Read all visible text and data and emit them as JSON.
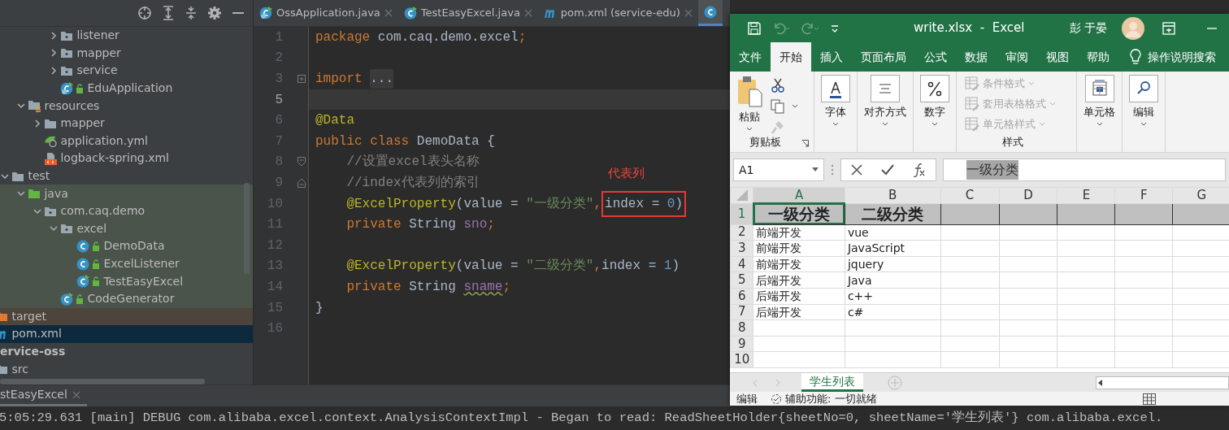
{
  "project": {
    "tree": [
      {
        "children": [
          {
            "children": [
              {
                "children": [
                  {
                    "children": [
                      {
                        "children": [
                          {
                            "label": "listener",
                            "kind": "package",
                            "expanded": false,
                            "selected": false
                          },
                          {
                            "label": "mapper",
                            "kind": "package",
                            "expanded": false,
                            "selected": false
                          },
                          {
                            "label": "service",
                            "kind": "package",
                            "expanded": false,
                            "selected": false
                          },
                          {
                            "label": "EduApplication",
                            "kind": "boot-class",
                            "selected": false
                          }
                        ]
                      }
                    ]
                  },
                  {
                    "label": "resources",
                    "kind": "resources",
                    "expanded": true,
                    "selected": false,
                    "children": [
                      {
                        "label": "mapper",
                        "kind": "folder",
                        "expanded": false,
                        "selected": false
                      },
                      {
                        "label": "application.yml",
                        "kind": "yml",
                        "selected": false
                      },
                      {
                        "label": "logback-spring.xml",
                        "kind": "xml",
                        "selected": false
                      }
                    ]
                  }
                ]
              },
              {
                "label": "test",
                "kind": "folder",
                "expanded": true,
                "selected": false,
                "children": [
                  {
                    "label": "java",
                    "kind": "test-root",
                    "expanded": true,
                    "selected": false,
                    "children": [
                      {
                        "label": "com.caq.demo",
                        "kind": "package",
                        "expanded": true,
                        "selected": false,
                        "children": [
                          {
                            "label": "excel",
                            "kind": "package",
                            "expanded": true,
                            "selected": false,
                            "children": [
                              {
                                "label": "DemoData",
                                "kind": "class",
                                "selected": false
                              },
                              {
                                "label": "ExcelListener",
                                "kind": "class",
                                "selected": false
                              },
                              {
                                "label": "TestEasyExcel",
                                "kind": "run-class",
                                "selected": false
                              }
                            ]
                          },
                          {
                            "label": "CodeGenerator",
                            "kind": "run-class",
                            "selected": false
                          }
                        ]
                      }
                    ]
                  }
                ]
              }
            ]
          },
          {
            "label": "target",
            "kind": "excluded-folder",
            "selected": false
          },
          {
            "label": "pom.xml",
            "kind": "maven",
            "selected": true
          }
        ]
      },
      {
        "label": "ervice-oss",
        "kind": "module",
        "selected": false,
        "children": [
          {
            "label": "src",
            "kind": "folder",
            "selected": false
          }
        ]
      }
    ]
  },
  "editor": {
    "tabs": [
      {
        "label": "OssApplication.java",
        "kind": "boot-class",
        "selected": false
      },
      {
        "label": "TestEasyExcel.java",
        "kind": "run-class",
        "selected": false
      },
      {
        "label": "pom.xml (service-edu)",
        "kind": "maven",
        "selected": false
      },
      {
        "kind": "class",
        "selected": true
      }
    ],
    "lines": [
      {
        "number": "1",
        "current": false,
        "tokens": [
          {
            "text": "package",
            "kind": "keyword"
          },
          {
            "text": " com.caq.demo.excel",
            "kind": "plain"
          },
          {
            "text": ";",
            "kind": "keyword"
          }
        ]
      },
      {
        "number": "2",
        "current": false
      },
      {
        "number": "3",
        "current": false,
        "fold": {
          "kind": "collapsed"
        },
        "tokens": [
          {
            "text": "import ",
            "kind": "keyword"
          },
          {
            "text": "...",
            "kind": "folded"
          }
        ]
      },
      {
        "number": "5",
        "current": true
      },
      {
        "number": "6",
        "current": false,
        "tokens": [
          {
            "text": "@Data",
            "kind": "annotation"
          }
        ]
      },
      {
        "number": "7",
        "current": false,
        "tokens": [
          {
            "text": "public class ",
            "kind": "keyword"
          },
          {
            "text": "DemoData {",
            "kind": "plain"
          }
        ]
      },
      {
        "number": "8",
        "current": false,
        "indented": true,
        "fold": {
          "kind": "open"
        },
        "tokens": [
          {
            "text": "//设置excel表头名称",
            "kind": "comment"
          }
        ]
      },
      {
        "number": "9",
        "current": false,
        "indented": true,
        "fold": {
          "kind": "close"
        },
        "tokens": [
          {
            "text": "//index代表列的索引",
            "kind": "comment"
          }
        ]
      },
      {
        "number": "10",
        "current": false,
        "indented": true,
        "callout": "代表列",
        "tokens": [
          {
            "text": "@ExcelProperty",
            "kind": "annotation"
          },
          {
            "text": "(value = ",
            "kind": "plain"
          },
          {
            "text": "\"一级分类\"",
            "kind": "string"
          },
          {
            "text": ",",
            "kind": "keyword"
          },
          {
            "text": "index = ",
            "kind": "plain",
            "boxed": true
          },
          {
            "text": "0",
            "kind": "number",
            "boxed": true
          },
          {
            "text": ")",
            "kind": "plain",
            "boxed": true
          }
        ]
      },
      {
        "number": "11",
        "current": false,
        "indented": true,
        "tokens": [
          {
            "text": "private ",
            "kind": "keyword"
          },
          {
            "text": "String ",
            "kind": "plain"
          },
          {
            "text": "sno",
            "kind": "field"
          },
          {
            "text": ";",
            "kind": "keyword"
          }
        ]
      },
      {
        "number": "12",
        "current": false
      },
      {
        "number": "13",
        "current": false,
        "indented": true,
        "tokens": [
          {
            "text": "@ExcelProperty",
            "kind": "annotation"
          },
          {
            "text": "(value = ",
            "kind": "plain"
          },
          {
            "text": "\"二级分类\"",
            "kind": "string"
          },
          {
            "text": ",",
            "kind": "keyword"
          },
          {
            "text": "index = ",
            "kind": "plain"
          },
          {
            "text": "1",
            "kind": "number"
          },
          {
            "text": ")",
            "kind": "plain"
          }
        ]
      },
      {
        "number": "14",
        "current": false,
        "indented": true,
        "tokens": [
          {
            "text": "private ",
            "kind": "keyword"
          },
          {
            "text": "String ",
            "kind": "plain"
          },
          {
            "text": "sname",
            "kind": "field",
            "warning": true
          },
          {
            "text": ";",
            "kind": "keyword"
          }
        ]
      },
      {
        "number": "15",
        "current": false,
        "tokens": [
          {
            "text": "}",
            "kind": "plain"
          }
        ]
      },
      {
        "number": "16",
        "current": false
      }
    ]
  },
  "run_panel": {
    "tab": "stEasyExcel",
    "console": "5:05:29.631 [main] DEBUG com.alibaba.excel.context.AnalysisContextImpl - Began to read: ReadSheetHolder{sheetNo=0, sheetName='学生列表'} com.alibaba.excel."
  },
  "excel": {
    "quick_access": [
      {
        "kind": "save",
        "disabled": false
      },
      {
        "kind": "undo",
        "disabled": true
      },
      {
        "kind": "redo",
        "disabled": true
      }
    ],
    "title": "write.xlsx  -  Excel",
    "user": "彭 于晏",
    "ribbon_tabs": [
      {
        "label": "文件",
        "selected": false
      },
      {
        "label": "开始",
        "selected": true
      },
      {
        "label": "插入",
        "selected": false
      },
      {
        "label": "页面布局",
        "selected": false
      },
      {
        "label": "公式",
        "selected": false
      },
      {
        "label": "数据",
        "selected": false
      },
      {
        "label": "审阅",
        "selected": false
      },
      {
        "label": "视图",
        "selected": false
      },
      {
        "label": "帮助",
        "selected": false
      }
    ],
    "tell_me": "操作说明搜索",
    "ribbon_groups": [
      {
        "kind": "clipboard",
        "button": "粘贴",
        "label": "剪贴板"
      },
      {
        "kind": "font",
        "button": "字体"
      },
      {
        "kind": "alignment",
        "button": "对齐方式"
      },
      {
        "kind": "number",
        "button": "数字"
      },
      {
        "kind": "styles",
        "label": "样式",
        "items": [
          {
            "label": "条件格式",
            "disabled": true
          },
          {
            "label": "套用表格格式",
            "disabled": true
          },
          {
            "label": "单元格样式",
            "disabled": true
          }
        ]
      },
      {
        "kind": "cells",
        "button": "单元格"
      },
      {
        "kind": "editing",
        "button": "编辑"
      }
    ],
    "name_box": "A1",
    "formula": "一级分类",
    "columns": [
      {
        "label": "A",
        "selected": true
      },
      {
        "label": "B",
        "selected": false
      },
      {
        "label": "C",
        "selected": false
      },
      {
        "label": "D",
        "selected": false
      },
      {
        "label": "E",
        "selected": false
      },
      {
        "label": "F",
        "selected": false
      },
      {
        "label": "G",
        "selected": false
      }
    ],
    "rows": [
      {
        "header": "1",
        "kind": "heading",
        "selected": true,
        "cells": [
          {
            "text": "一级分类",
            "selected": true
          },
          {
            "text": "二级分类",
            "selected": false
          }
        ]
      },
      {
        "header": "2",
        "kind": "data",
        "selected": false,
        "cells": [
          {
            "text": "前端开发",
            "selected": false
          },
          {
            "text": "vue",
            "selected": false
          }
        ]
      },
      {
        "header": "3",
        "kind": "data",
        "selected": false,
        "cells": [
          {
            "text": "前端开发",
            "selected": false
          },
          {
            "text": "JavaScript",
            "selected": false
          }
        ]
      },
      {
        "header": "4",
        "kind": "data",
        "selected": false,
        "cells": [
          {
            "text": "前端开发",
            "selected": false
          },
          {
            "text": "jquery",
            "selected": false
          }
        ]
      },
      {
        "header": "5",
        "kind": "data",
        "selected": false,
        "cells": [
          {
            "text": "后端开发",
            "selected": false
          },
          {
            "text": "Java",
            "selected": false
          }
        ]
      },
      {
        "header": "6",
        "kind": "data",
        "selected": false,
        "cells": [
          {
            "text": "后端开发",
            "selected": false
          },
          {
            "text": "c++",
            "selected": false
          }
        ]
      },
      {
        "header": "7",
        "kind": "data",
        "selected": false,
        "cells": [
          {
            "text": "后端开发",
            "selected": false
          },
          {
            "text": "c#",
            "selected": false
          }
        ]
      },
      {
        "header": "8",
        "kind": "data",
        "selected": false
      },
      {
        "header": "9",
        "kind": "data",
        "selected": false
      },
      {
        "header": "10",
        "kind": "data",
        "selected": false
      }
    ],
    "sheets": [
      {
        "label": "学生列表",
        "selected": true
      }
    ],
    "status": "编辑",
    "accessibility": "辅助功能: 一切就绪"
  }
}
